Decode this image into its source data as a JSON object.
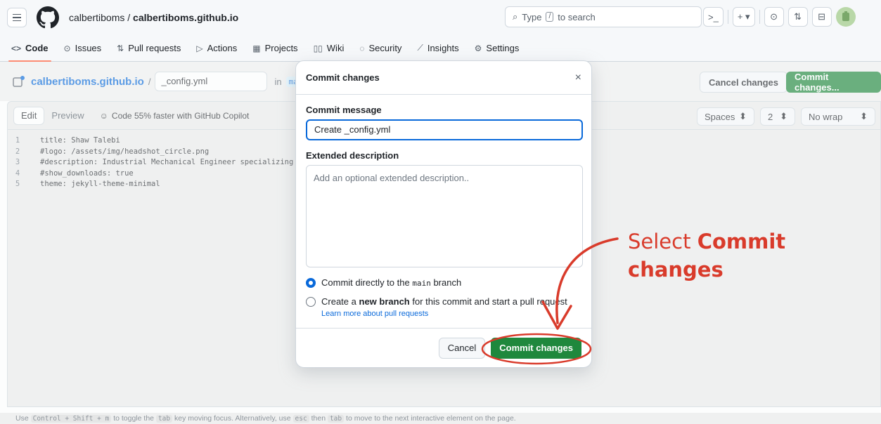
{
  "header": {
    "owner": "calbertiboms",
    "separator": " / ",
    "repo": "calbertiboms.github.io",
    "search_placeholder": "Type",
    "search_key": "/",
    "search_suffix": "to search",
    "terminal_icon": ">_",
    "plus_label": "+ ▾"
  },
  "repo_nav": {
    "items": [
      {
        "label": "Code",
        "icon": "<>"
      },
      {
        "label": "Issues",
        "icon": "⊙"
      },
      {
        "label": "Pull requests",
        "icon": "⇅"
      },
      {
        "label": "Actions",
        "icon": "▷"
      },
      {
        "label": "Projects",
        "icon": "▦"
      },
      {
        "label": "Wiki",
        "icon": "▯▯"
      },
      {
        "label": "Security",
        "icon": "◌"
      },
      {
        "label": "Insights",
        "icon": "⟋"
      },
      {
        "label": "Settings",
        "icon": "⚙"
      }
    ]
  },
  "editor": {
    "repo_link": "calbertiboms.github.io",
    "slash": "/",
    "filename": "_config.yml",
    "in_label": "in",
    "branch": "main",
    "cancel_label": "Cancel changes",
    "commit_label": "Commit changes...",
    "tab_edit": "Edit",
    "tab_preview": "Preview",
    "copilot_text": "Code 55% faster with GitHub Copilot",
    "spaces_label": "Spaces",
    "indent_value": "2",
    "wrap_label": "No wrap",
    "lines": [
      {
        "n": "1",
        "text": "title: Shaw Talebi"
      },
      {
        "n": "2",
        "text": "#logo: /assets/img/headshot_circle.png"
      },
      {
        "n": "3",
        "text": "#description: Industrial Mechanical Engineer specializing"
      },
      {
        "n": "4",
        "text": "#show_downloads: true"
      },
      {
        "n": "5",
        "text": "theme: jekyll-theme-minimal"
      }
    ]
  },
  "footer": {
    "p1": "Use",
    "k1": "Control + Shift + m",
    "p2": "to toggle the",
    "k2": "tab",
    "p3": "key moving focus. Alternatively, use",
    "k3": "esc",
    "p4": "then",
    "k4": "tab",
    "p5": "to move to the next interactive element on the page."
  },
  "modal": {
    "title": "Commit changes",
    "close": "×",
    "message_label": "Commit message",
    "message_value": "Create _config.yml",
    "description_label": "Extended description",
    "description_placeholder": "Add an optional extended description..",
    "option1_pre": "Commit directly to the",
    "option1_branch": "main",
    "option1_post": "branch",
    "option2_pre": "Create a",
    "option2_bold": "new branch",
    "option2_post": "for this commit and start a pull request",
    "learn_more": "Learn more about pull requests",
    "cancel_label": "Cancel",
    "commit_label": "Commit changes"
  },
  "annotation": {
    "line1_normal": "Select ",
    "line1_bold": "Commit",
    "line2_bold": "changes",
    "color": "#d93b2b"
  },
  "colors": {
    "accent_green": "#1f883d",
    "link_blue": "#0969da"
  }
}
